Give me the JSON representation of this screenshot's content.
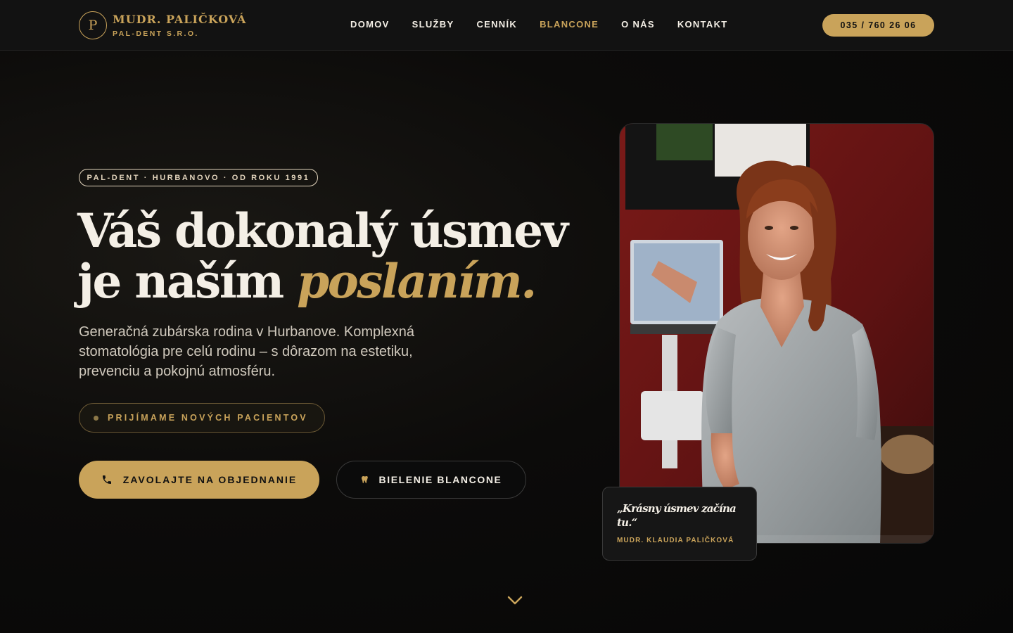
{
  "brand": {
    "monogram": "P",
    "name": "MUDR. PALIČKOVÁ",
    "sub": "PAL-DENT S.R.O."
  },
  "nav": {
    "items": [
      {
        "label": "DOMOV",
        "active": false
      },
      {
        "label": "SLUŽBY",
        "active": false
      },
      {
        "label": "CENNÍK",
        "active": false
      },
      {
        "label": "BLANCONE",
        "active": true
      },
      {
        "label": "O NÁS",
        "active": false
      },
      {
        "label": "KONTAKT",
        "active": false
      }
    ],
    "phone": "035 / 760 26 06"
  },
  "hero": {
    "badge": "PAL-DENT · HURBANOVO · OD ROKU 1991",
    "title_line1": "Váš dokonalý úsmev",
    "title_line2_plain": "je naším ",
    "title_line2_accent": "poslaním.",
    "lead": "Generačná zubárska rodina v Hurbanove. Komplexná stomatológia pre celú rodinu – s dôrazom na estetiku, prevenciu a pokojnú atmosféru.",
    "status": "PRIJÍMAME NOVÝCH PACIENTOV",
    "cta_primary": "ZAVOLAJTE NA OBJEDNANIE",
    "cta_secondary": "BIELENIE BLANCONE"
  },
  "quote": {
    "text": "„Krásny úsmev začína tu.“",
    "author": "MUDR. KLAUDIA PALIČKOVÁ"
  },
  "colors": {
    "accent": "#c9a35a",
    "background": "#0c0b0a",
    "text": "#f4efe6"
  },
  "icons": {
    "phone": "phone-icon",
    "tooth": "tooth-icon",
    "scroll": "chevron-down-icon"
  }
}
